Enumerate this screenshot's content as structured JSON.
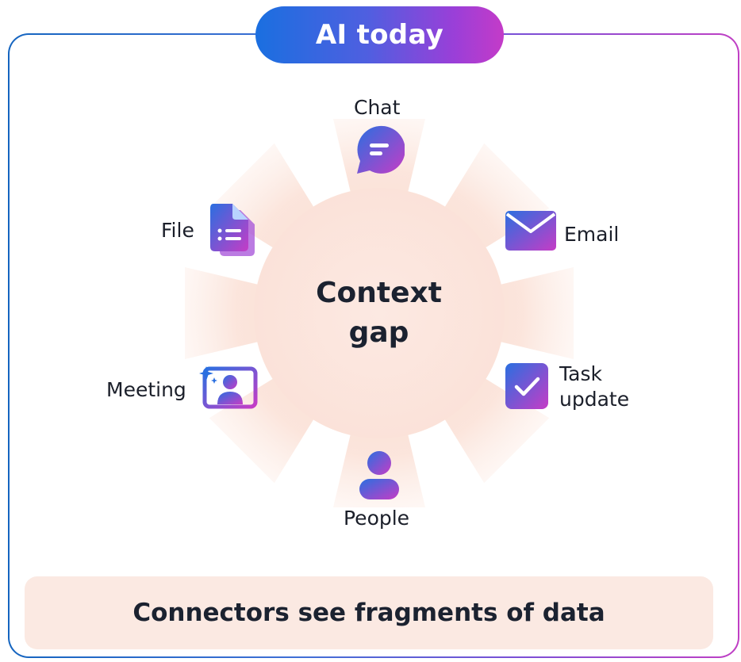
{
  "header": {
    "title": "AI today"
  },
  "center": {
    "line1": "Context",
    "line2": "gap"
  },
  "nodes": {
    "chat": "Chat",
    "email": "Email",
    "task_line1": "Task",
    "task_line2": "update",
    "people": "People",
    "meeting": "Meeting",
    "file": "File"
  },
  "footer": {
    "caption": "Connectors see fragments of data"
  },
  "icons": [
    "chat-icon",
    "email-icon",
    "task-check-icon",
    "person-icon",
    "meeting-icon",
    "file-icon"
  ],
  "colors": {
    "gradient_start": "#1a6fe0",
    "gradient_end": "#c43bc8",
    "burst": "#fbe3da",
    "footer_bg": "#fbe9e2"
  }
}
